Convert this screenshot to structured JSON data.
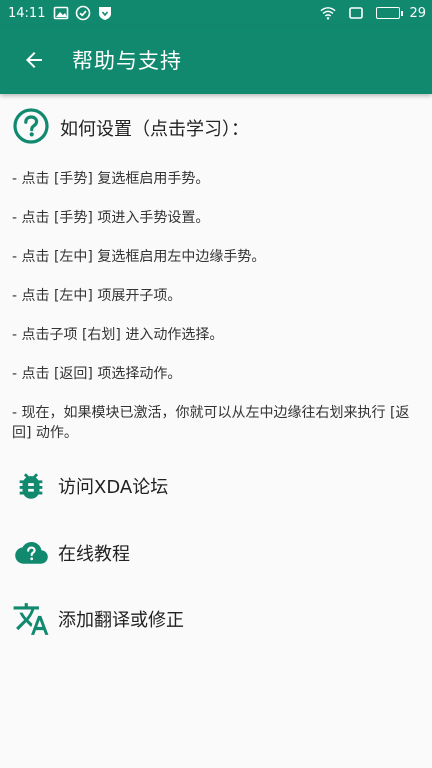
{
  "status_bar": {
    "time": "14:11",
    "battery_level": "29",
    "battery_fraction": 0.29
  },
  "toolbar": {
    "back_icon": "arrow-back-icon",
    "title": "帮助与支持"
  },
  "howto": {
    "icon": "help-circle-icon",
    "title": "如何设置（点击学习）："
  },
  "steps": [
    "- 点击 [手势] 复选框启用手势。",
    "- 点击 [手势] 项进入手势设置。",
    "- 点击 [左中] 复选框启用左中边缘手势。",
    "- 点击 [左中] 项展开子项。",
    "- 点击子项 [右划] 进入动作选择。",
    "- 点击 [返回] 项选择动作。",
    "- 现在，如果模块已激活，你就可以从左中边缘往右划来执行 [返回] 动作。"
  ],
  "links": [
    {
      "icon": "bug-icon",
      "label": "访问XDA论坛"
    },
    {
      "icon": "cloud-help-icon",
      "label": "在线教程"
    },
    {
      "icon": "translate-icon",
      "label": "添加翻译或修正"
    }
  ],
  "colors": {
    "primary": "#11896f",
    "icon": "#11896f",
    "text": "#212121",
    "background": "#fafafa"
  }
}
